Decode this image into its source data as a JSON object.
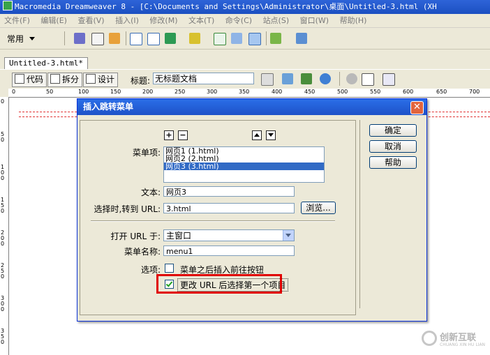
{
  "window_title": "Macromedia Dreamweaver 8 - [C:\\Documents and Settings\\Administrator\\桌面\\Untitled-3.html (XH",
  "menubar": [
    "文件(F)",
    "编辑(E)",
    "查看(V)",
    "插入(I)",
    "修改(M)",
    "文本(T)",
    "命令(C)",
    "站点(S)",
    "窗口(W)",
    "帮助(H)"
  ],
  "insert_bar": {
    "category": "常用"
  },
  "document_tab": "Untitled-3.html*",
  "doc_toolbar": {
    "code_label": "代码",
    "split_label": "拆分",
    "design_label": "设计",
    "title_label": "标题:",
    "title_value": "无标题文档"
  },
  "ruler": {
    "h_labels": [
      "0",
      "50",
      "100",
      "150",
      "200",
      "250",
      "300",
      "350",
      "400",
      "450",
      "500",
      "550",
      "600",
      "650",
      "700"
    ],
    "v_labels": [
      "0",
      "50",
      "100",
      "150",
      "200",
      "250",
      "300",
      "350"
    ]
  },
  "dialog": {
    "title": "插入跳转菜单",
    "menu_items_label": "菜单项:",
    "menu_items": [
      "网页1 (1.html)",
      "网页2 (2.html)",
      "网页3 (3.html)"
    ],
    "selected_index": 2,
    "plus": "+",
    "minus": "−",
    "text_label": "文本:",
    "text_value": "网页3",
    "url_label": "选择时,转到 URL:",
    "url_value": "3.html",
    "browse_label": "浏览...",
    "open_url_label": "打开 URL 于:",
    "open_url_value": "主窗口",
    "menu_name_label": "菜单名称:",
    "menu_name_value": "menu1",
    "options_label": "选项:",
    "option_insert_go_button": {
      "label": "菜单之后插入前往按钮",
      "checked": false
    },
    "option_select_first": {
      "label": "更改 URL 后选择第一个项目",
      "checked": true
    },
    "ok_label": "确定",
    "cancel_label": "取消",
    "help_label": "帮助",
    "highlight_color": "#e00000"
  },
  "watermark": {
    "text": "创新互联",
    "subtext": "CHUANG XIN HU LIAN"
  }
}
